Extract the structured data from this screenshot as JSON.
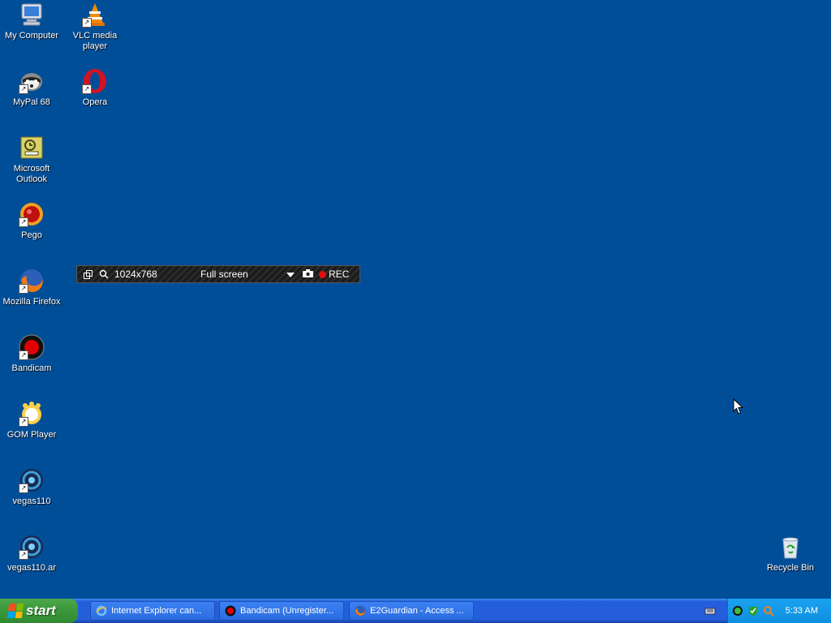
{
  "desktop": {
    "background_color": "#004e98",
    "icons": [
      {
        "label": "My Computer",
        "icon": "my-computer-icon"
      },
      {
        "label": "VLC media player",
        "icon": "vlc-icon"
      },
      {
        "label": "MyPal 68",
        "icon": "mypal-icon"
      },
      {
        "label": "Opera",
        "icon": "opera-icon"
      },
      {
        "label": "Microsoft Outlook",
        "icon": "outlook-icon"
      },
      {
        "label": "Pego",
        "icon": "pego-icon"
      },
      {
        "label": "Mozilla Firefox",
        "icon": "firefox-icon"
      },
      {
        "label": "Bandicam",
        "icon": "bandicam-icon"
      },
      {
        "label": "GOM Player",
        "icon": "gom-player-icon"
      },
      {
        "label": "vegas110",
        "icon": "vegas-icon"
      },
      {
        "label": "vegas110.ar",
        "icon": "vegas-icon"
      },
      {
        "label": "Recycle Bin",
        "icon": "recycle-bin-icon"
      }
    ]
  },
  "bandicam_bar": {
    "resolution": "1024x768",
    "mode": "Full screen",
    "rec_label": "REC"
  },
  "taskbar": {
    "start_label": "start",
    "tasks": [
      {
        "label": "Internet Explorer can...",
        "icon": "internet-explorer-icon"
      },
      {
        "label": "Bandicam (Unregister...",
        "icon": "bandicam-icon"
      },
      {
        "label": "E2Guardian - Access ...",
        "icon": "firefox-icon"
      }
    ],
    "clock": "5:33 AM"
  }
}
